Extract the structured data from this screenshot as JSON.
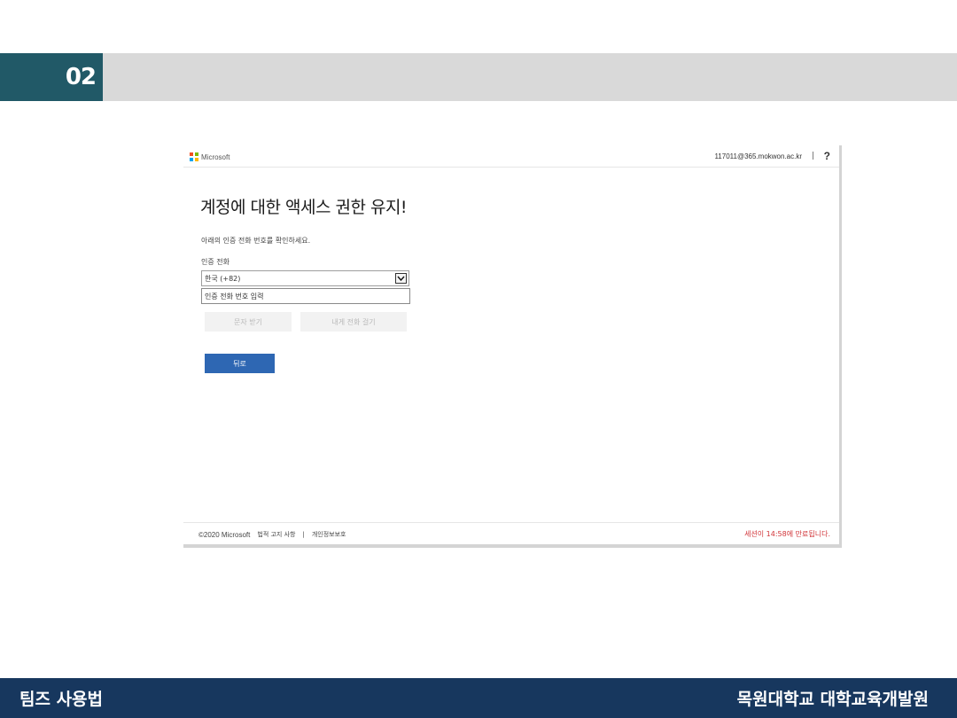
{
  "slide": {
    "section_number": "02",
    "footer_left": "팀즈 사용법",
    "footer_right": "목원대학교 대학교육개발원"
  },
  "ms": {
    "logo_text": "Microsoft",
    "logo_colors": [
      "#f25022",
      "#7fba00",
      "#00a4ef",
      "#ffb900"
    ],
    "account": "117011@365.mokwon.ac.kr",
    "separator": "|",
    "help": "?",
    "title": "계정에 대한 액세스 권한 유지!",
    "description": "아래의 인증 전화 번호를 확인하세요.",
    "phone_label": "인증 전화",
    "country_select_value": "한국 (+82)",
    "phone_input_placeholder": "인증 전화 번호 입력",
    "btn_sms": "문자 받기",
    "btn_call": "내게 전화 걸기",
    "btn_back": "뒤로",
    "footer": {
      "copyright": "©2020 Microsoft",
      "legal": "법적 고지 사항",
      "sep": "|",
      "privacy": "개인정보보호"
    },
    "session_notice": "세션이 14:58에 만료됩니다.",
    "colors": {
      "accent_blue": "#2e67b3",
      "session_red": "#d13438"
    }
  }
}
